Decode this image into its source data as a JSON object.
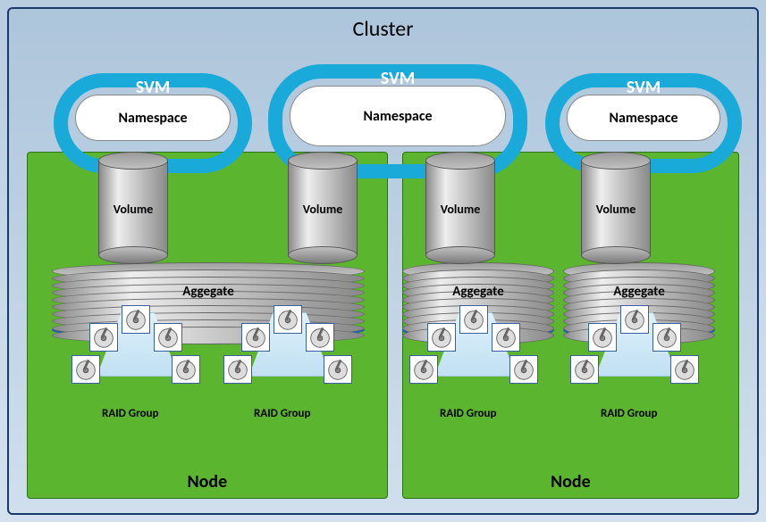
{
  "title": "Cluster",
  "svms": [
    {
      "label": "SVM",
      "namespace": "Namespace"
    },
    {
      "label": "SVM",
      "namespace": "Namespace"
    },
    {
      "label": "SVM",
      "namespace": "Namespace"
    }
  ],
  "volumes": [
    {
      "label": "Volume"
    },
    {
      "label": "Volume"
    },
    {
      "label": "Volume"
    },
    {
      "label": "Volume"
    }
  ],
  "aggregates": [
    {
      "label": "Aggegate"
    },
    {
      "label": "Aggegate"
    },
    {
      "label": "Aggegate"
    }
  ],
  "raid_groups": [
    {
      "label": "RAID Group",
      "disks": 5
    },
    {
      "label": "RAID Group",
      "disks": 5
    },
    {
      "label": "RAID Group",
      "disks": 5
    },
    {
      "label": "RAID Group",
      "disks": 5
    }
  ],
  "nodes": [
    {
      "label": "Node"
    },
    {
      "label": "Node"
    }
  ]
}
